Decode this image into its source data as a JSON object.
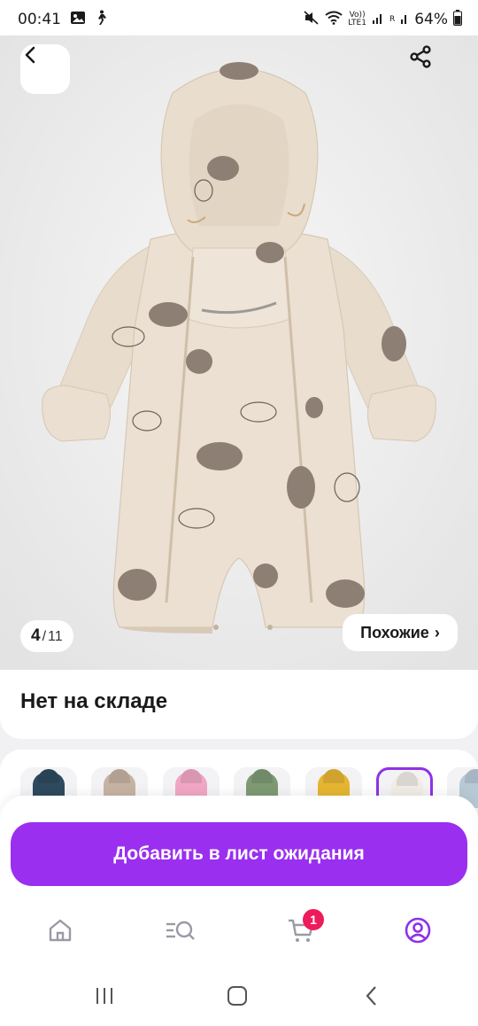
{
  "status_bar": {
    "time": "00:41",
    "network_top": "Vo))",
    "network_bottom": "LTE1",
    "signal2_label": "R",
    "battery": "64%"
  },
  "gallery": {
    "current": "4",
    "separator": "/",
    "total": "11",
    "similar_label": "Похожие",
    "similar_chevron": "›"
  },
  "product": {
    "stock_status": "Нет на складе"
  },
  "variants": [
    {
      "color": "#2e4a5e",
      "selected": false
    },
    {
      "color": "#c6b3a3",
      "selected": false
    },
    {
      "color": "#f1a7c4",
      "selected": false
    },
    {
      "color": "#7e9a74",
      "selected": false
    },
    {
      "color": "#e6b532",
      "selected": false
    },
    {
      "color": "#f1ede6",
      "selected": true
    },
    {
      "color": "#b8c9d6",
      "selected": false
    }
  ],
  "actions": {
    "waitlist_label": "Добавить в лист ожидания"
  },
  "bottom_nav": {
    "cart_badge": "1",
    "items": [
      "home-icon",
      "catalog-search-icon",
      "cart-icon",
      "profile-icon"
    ]
  },
  "colors": {
    "accent": "#9a2ff0",
    "badge": "#ee1b5b",
    "active_nav": "#8e32e6"
  }
}
